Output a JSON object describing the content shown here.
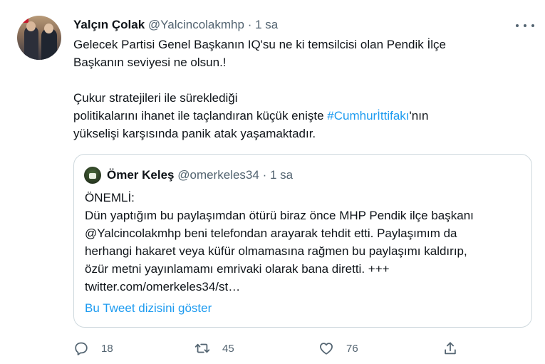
{
  "tweet": {
    "author_name": "Yalçın Çolak",
    "author_handle": "@Yalcincolakmhp",
    "separator": "·",
    "time": "1 sa",
    "line1": "Gelecek Partisi Genel Başkanın IQ'su ne ki temsilcisi olan Pendik İlçe",
    "line2": "Başkanın seviyesi ne olsun.!",
    "line3": "Çukur stratejileri ile sürekledi​ği",
    "line4_before": "politikalarını ihanet ile taçlandıran küçük enişte ",
    "hashtag": "#Cumhurİttifakı",
    "line4_after": "'nın",
    "line5": "yükselişi karşısında panik atak yaşamaktadır."
  },
  "quote": {
    "author_name": "Ömer Keleş",
    "author_handle": "@omerkeles34",
    "separator": "·",
    "time": "1 sa",
    "lines": [
      "ÖNEMLİ:",
      "Dün yaptığım bu paylaşımdan ötürü biraz önce MHP Pendik ilçe başkanı",
      "@Yalcincolakmhp beni telefondan arayarak tehdit etti. Paylaşımım da",
      "herhangi hakaret veya küfür olmamasına rağmen bu paylaşımı kaldırıp,",
      "özür metni yayınlamamı emrivaki olarak bana diretti. +++",
      "twitter.com/omerkeles34/st…"
    ],
    "show_thread": "Bu Tweet dizisini göster"
  },
  "actions": {
    "reply_count": "18",
    "retweet_count": "45",
    "like_count": "76",
    "icons": [
      "reply-icon",
      "retweet-icon",
      "like-icon",
      "share-icon"
    ]
  },
  "colors": {
    "accent": "#1d9bf0",
    "text": "#0f1419",
    "secondary": "#536471",
    "border": "#cfd9de"
  }
}
